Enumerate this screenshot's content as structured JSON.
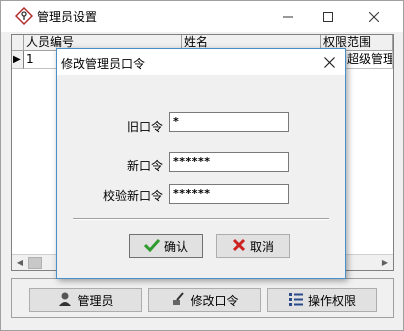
{
  "window": {
    "title": "管理员设置"
  },
  "grid": {
    "columns": [
      "人员编号",
      "姓名",
      "权限范围"
    ],
    "rows": [
      {
        "marker": "▶",
        "id": "1",
        "name": "",
        "scope": "超级管理"
      }
    ]
  },
  "toolbar": {
    "admin_label": "管理员",
    "change_password_label": "修改口令",
    "permissions_label": "操作权限"
  },
  "dialog": {
    "title": "修改管理员口令",
    "old_label": "旧口令",
    "old_value": "*",
    "new_label": "新口令",
    "new_value": "******",
    "confirm_label": "校验新口令",
    "confirm_value": "******",
    "ok_label": "确认",
    "cancel_label": "取消"
  },
  "icons": {
    "app": "key-icon",
    "ok": "check-icon",
    "cancel": "x-icon"
  },
  "colors": {
    "ok_green": "#2e9b2e",
    "cancel_red": "#cc2222",
    "dialog_border": "#4a90c8"
  }
}
